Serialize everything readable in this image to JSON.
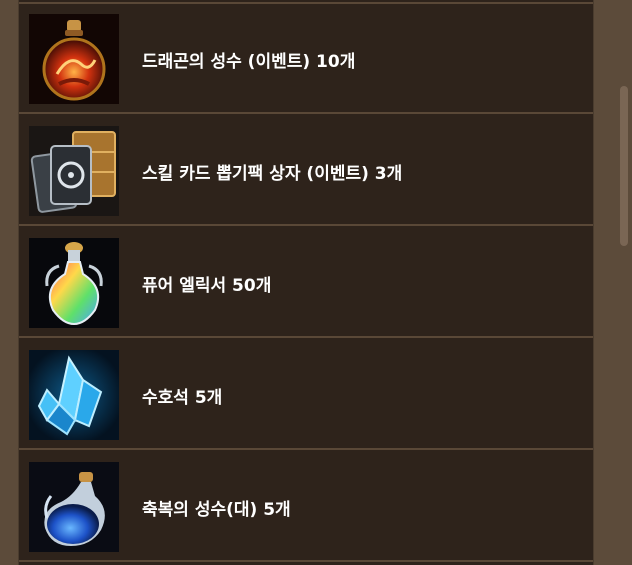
{
  "items": [
    {
      "label": "드래곤의 성수 (이벤트) 10개",
      "icon": "dragon-holy-water-icon"
    },
    {
      "label": "스킬 카드 뽑기팩 상자 (이벤트) 3개",
      "icon": "skill-card-pack-box-icon"
    },
    {
      "label": "퓨어 엘릭서 50개",
      "icon": "pure-elixir-icon"
    },
    {
      "label": "수호석 5개",
      "icon": "guardian-stone-icon"
    },
    {
      "label": "축복의 성수(대) 5개",
      "icon": "blessed-holy-water-large-icon"
    }
  ],
  "colors": {
    "page_background": "#5c4b3a",
    "panel_background": "#2e231b",
    "divider": "#5a4837",
    "text": "#ffffff"
  }
}
